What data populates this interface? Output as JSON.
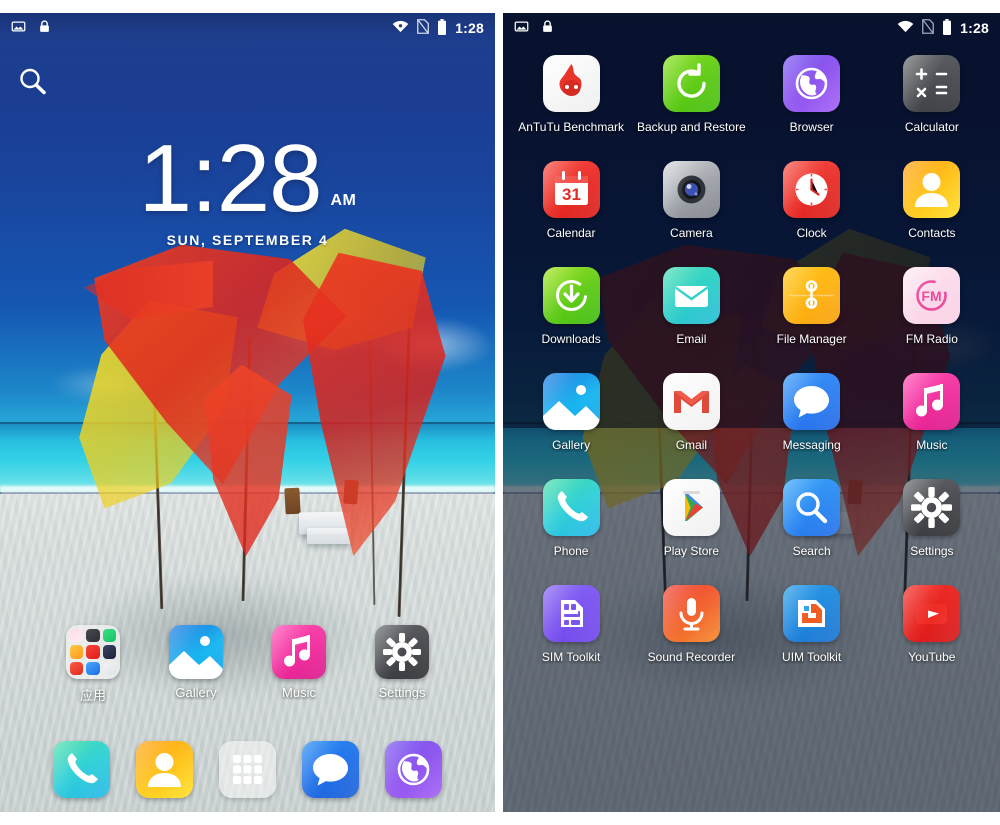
{
  "statusbar": {
    "screenshot_icon": "screenshot-icon",
    "lock_icon": "lock-icon",
    "wifi_icon": "wifi-icon",
    "sim_icon": "no-sim-icon",
    "battery_icon": "battery-icon",
    "time": "1:28"
  },
  "lockscreen": {
    "search_icon": "search-icon",
    "time": "1:28",
    "ampm": "AM",
    "date": "SUN, SEPTEMBER 4",
    "home_row": [
      {
        "label": "应用",
        "icon": "folder-icon"
      },
      {
        "label": "Gallery",
        "icon": "gallery-icon"
      },
      {
        "label": "Music",
        "icon": "music-icon"
      },
      {
        "label": "Settings",
        "icon": "settings-icon"
      }
    ],
    "dock": [
      {
        "label": "Phone",
        "icon": "phone-icon"
      },
      {
        "label": "Contacts",
        "icon": "contacts-icon"
      },
      {
        "label": "All Apps",
        "icon": "app-drawer-icon"
      },
      {
        "label": "Messaging",
        "icon": "messaging-icon"
      },
      {
        "label": "Browser",
        "icon": "browser-icon"
      }
    ]
  },
  "drawer": {
    "apps": [
      {
        "label": "AnTuTu Benchmark",
        "icon": "antutu-icon"
      },
      {
        "label": "Backup and Restore",
        "icon": "backup-restore-icon"
      },
      {
        "label": "Browser",
        "icon": "browser-icon"
      },
      {
        "label": "Calculator",
        "icon": "calculator-icon"
      },
      {
        "label": "Calendar",
        "icon": "calendar-icon"
      },
      {
        "label": "Camera",
        "icon": "camera-icon"
      },
      {
        "label": "Clock",
        "icon": "clock-icon"
      },
      {
        "label": "Contacts",
        "icon": "contacts-icon"
      },
      {
        "label": "Downloads",
        "icon": "downloads-icon"
      },
      {
        "label": "Email",
        "icon": "email-icon"
      },
      {
        "label": "File Manager",
        "icon": "file-manager-icon"
      },
      {
        "label": "FM Radio",
        "icon": "fm-radio-icon"
      },
      {
        "label": "Gallery",
        "icon": "gallery-icon"
      },
      {
        "label": "Gmail",
        "icon": "gmail-icon"
      },
      {
        "label": "Messaging",
        "icon": "messaging-icon"
      },
      {
        "label": "Music",
        "icon": "music-icon"
      },
      {
        "label": "Phone",
        "icon": "phone-icon"
      },
      {
        "label": "Play Store",
        "icon": "play-store-icon"
      },
      {
        "label": "Search",
        "icon": "search-icon"
      },
      {
        "label": "Settings",
        "icon": "settings-icon"
      },
      {
        "label": "SIM Toolkit",
        "icon": "sim-toolkit-icon"
      },
      {
        "label": "Sound Recorder",
        "icon": "sound-recorder-icon"
      },
      {
        "label": "UIM Toolkit",
        "icon": "uim-toolkit-icon"
      },
      {
        "label": "YouTube",
        "icon": "youtube-icon"
      }
    ]
  },
  "colors": {
    "sky_blue": "#1b3d92",
    "sea_cyan": "#27bfe0",
    "sand": "#d6dcdb",
    "canopy_red": "#e8342a",
    "canopy_yellow": "#f2e01f",
    "statusbar_text": "#ffffff",
    "drawer_dim": "#0a1224"
  }
}
